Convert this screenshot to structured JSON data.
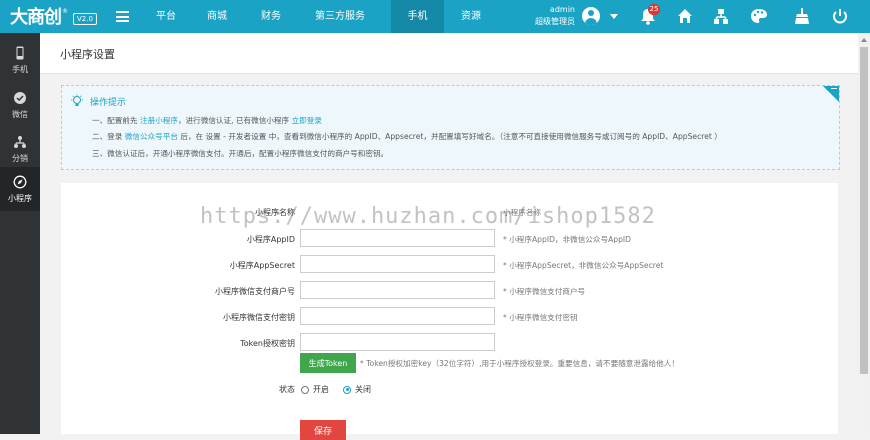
{
  "app": {
    "logo_text": "大商创",
    "logo_reg": "®",
    "version": "V2.0"
  },
  "nav": {
    "tabs": [
      {
        "label": "平台",
        "active": false
      },
      {
        "label": "商城",
        "active": false
      },
      {
        "label": "财务",
        "active": false
      },
      {
        "label": "第三方服务",
        "active": false
      },
      {
        "label": "手机",
        "active": true
      },
      {
        "label": "资源",
        "active": false
      }
    ]
  },
  "user": {
    "name": "admin",
    "role": "超级管理员"
  },
  "notifications": {
    "count": "25"
  },
  "sidebar": {
    "items": [
      {
        "label": "手机",
        "icon": "mobile-icon",
        "active": false
      },
      {
        "label": "微信",
        "icon": "wechat-icon",
        "active": false
      },
      {
        "label": "分销",
        "icon": "distribution-icon",
        "active": false
      },
      {
        "label": "小程序",
        "icon": "compass-icon",
        "active": true
      }
    ]
  },
  "page": {
    "title": "小程序设置"
  },
  "tips": {
    "title": "操作提示",
    "line1": {
      "pre": "一、配置前先 ",
      "link1": "注册小程序",
      "mid": "，进行微信认证, 已有微信小程序 ",
      "link2": "立即登录"
    },
    "line2": {
      "pre": "二、登录 ",
      "link": "微信公众号平台",
      "post": " 后，在 设置 - 开发者设置 中，查看到微信小程序的 AppID、Appsecret，并配置填写好域名。（注意不可直接使用微信服务号或订阅号的 AppID、AppSecret ）"
    },
    "line3": "三、微信认证后，开通小程序微信支付。开通后，配置小程序微信支付的商户号和密钥。"
  },
  "form": {
    "name": {
      "label": "小程序名称",
      "value": "",
      "hint": "小程序名称"
    },
    "appid": {
      "label": "小程序AppID",
      "value": "",
      "hint": "* 小程序AppID，非微信公众号AppID"
    },
    "appsecret": {
      "label": "小程序AppSecret",
      "value": "",
      "hint": "* 小程序AppSecret，非微信公众号AppSecret"
    },
    "mchid": {
      "label": "小程序微信支付商户号",
      "value": "",
      "hint": "* 小程序微信支付商户号"
    },
    "paykey": {
      "label": "小程序微信支付密钥",
      "value": "",
      "hint": "* 小程序微信支付密钥"
    },
    "token": {
      "label": "Token授权密钥",
      "value": "",
      "button": "生成Token",
      "hint": "* Token授权加密key（32位字符）,用于小程序授权登录。重要信息，请不要随意泄露给他人！"
    },
    "status": {
      "label": "状态",
      "options": [
        "开启",
        "关闭"
      ],
      "selected": "关闭"
    },
    "save": "保存"
  },
  "watermark": "https://www.huzhan.com/ishop1582",
  "colors": {
    "topbar": "#1ba3c6",
    "topbar_active": "#1587a7",
    "sidebar": "#2f3336",
    "primary_button": "#3fa64c",
    "save_button": "#e1473e",
    "badge": "#e0352b"
  }
}
